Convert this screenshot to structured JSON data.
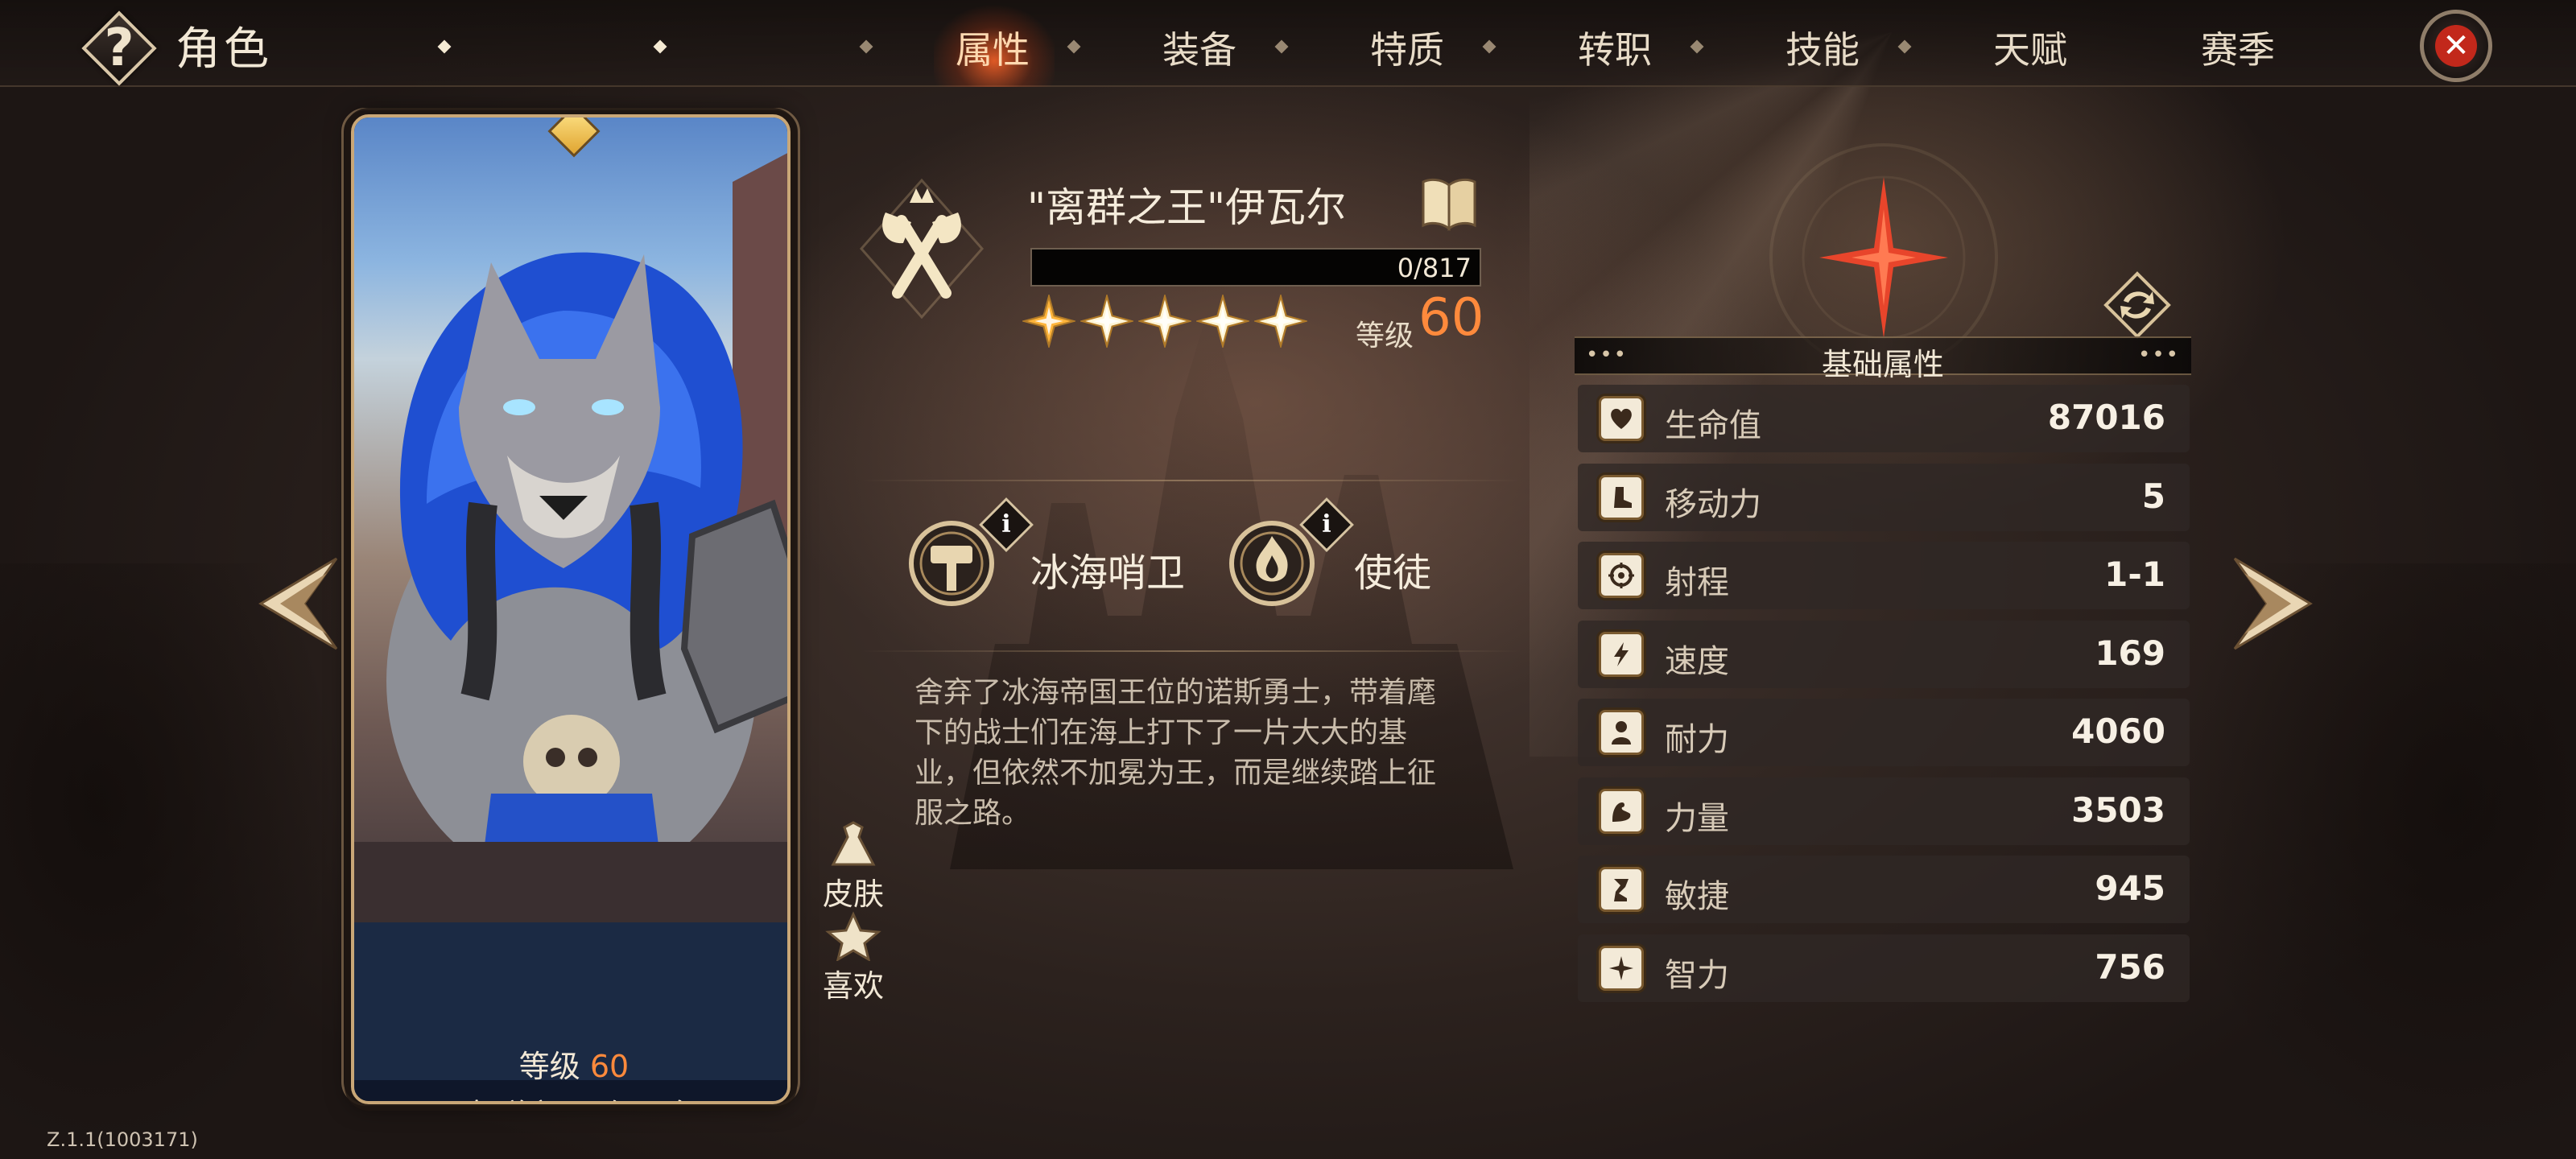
{
  "header": {
    "title": "角色",
    "tabs": [
      {
        "label": "属性",
        "active": true
      },
      {
        "label": "装备",
        "active": false
      },
      {
        "label": "特质",
        "active": false
      },
      {
        "label": "转职",
        "active": false
      },
      {
        "label": "技能",
        "active": false
      },
      {
        "label": "天赋",
        "active": false
      },
      {
        "label": "赛季",
        "active": false
      }
    ]
  },
  "card": {
    "level_label": "等级",
    "level_value": "60",
    "name": "\"离群之王\"伊瓦尔",
    "stars": 5
  },
  "side_buttons": {
    "skin_label": "皮肤",
    "like_label": "喜欢"
  },
  "hero": {
    "name": "\"离群之王\"伊瓦尔",
    "exp_text": "0/817",
    "exp_fraction": 0,
    "stars": 5,
    "level_label": "等级",
    "level_value": "60",
    "traits": [
      {
        "label": "冰海哨卫",
        "icon": "hammer-emblem-icon"
      },
      {
        "label": "使徒",
        "icon": "flame-emblem-icon"
      }
    ],
    "description": "舍弃了冰海帝国王位的诺斯勇士，带着麾下的战士们在海上打下了一片大大的基业，但依然不加冕为王，而是继续踏上征服之路。"
  },
  "stats": {
    "header": "基础属性",
    "rows": [
      {
        "name": "生命值",
        "value": "87016",
        "icon": "heart-icon"
      },
      {
        "name": "移动力",
        "value": "5",
        "icon": "boot-icon"
      },
      {
        "name": "射程",
        "value": "1-1",
        "icon": "target-icon"
      },
      {
        "name": "速度",
        "value": "169",
        "icon": "lightning-icon"
      },
      {
        "name": "耐力",
        "value": "4060",
        "icon": "person-icon"
      },
      {
        "name": "力量",
        "value": "3503",
        "icon": "arm-icon"
      },
      {
        "name": "敏捷",
        "value": "945",
        "icon": "leg-icon"
      },
      {
        "name": "智力",
        "value": "756",
        "icon": "sparkle-icon"
      }
    ]
  },
  "info_badge": "i",
  "version": "Z.1.1(1003171)",
  "colors": {
    "accent_level": "#ff8a3c",
    "tab_active_glow": "#ff6428",
    "close_red": "#c2281b",
    "star_gold": "#ffd76a"
  }
}
